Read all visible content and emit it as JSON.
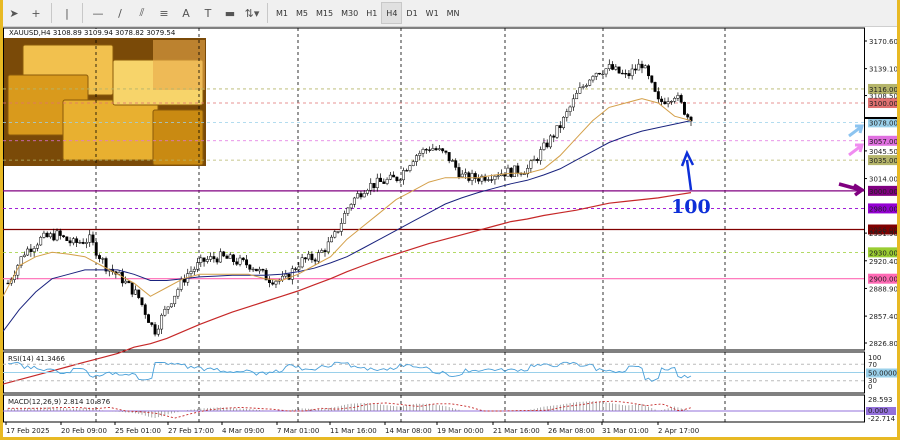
{
  "toolbar": {
    "tools": [
      {
        "name": "cursor-icon",
        "g": "➤"
      },
      {
        "name": "crosshair-icon",
        "g": "+"
      },
      {
        "name": "vertical-line-icon",
        "g": "|"
      },
      {
        "name": "horizontal-line-icon",
        "g": "—"
      },
      {
        "name": "trendline-icon",
        "g": "/"
      },
      {
        "name": "channels-icon",
        "g": "⫽"
      },
      {
        "name": "fibonacci-icon",
        "g": "≡"
      },
      {
        "name": "text-icon",
        "g": "A"
      },
      {
        "name": "text-label-icon",
        "g": "T"
      },
      {
        "name": "rectangle-icon",
        "g": "▬"
      },
      {
        "name": "arrows-icon",
        "g": "⇅▾"
      }
    ],
    "timeframes": [
      "M1",
      "M5",
      "M15",
      "M30",
      "H1",
      "H4",
      "D1",
      "W1",
      "MN"
    ],
    "active_timeframe": "H4"
  },
  "chart": {
    "symbol_header": "XAUUSD,H4  3108.89 3109.94 3078.82 3079.54",
    "price_ticks": [
      "3170.60",
      "3139.10",
      "3108.50",
      "3045.50",
      "3014.00",
      "2951.90",
      "2920.40",
      "2888.90",
      "2857.40",
      "2826.80"
    ],
    "levels": [
      {
        "label": "3116.00",
        "price": 3116,
        "color": "#b5b56a",
        "style": "dot"
      },
      {
        "label": "3100.00",
        "price": 3100,
        "color": "#e07070",
        "style": "dot"
      },
      {
        "label": "3078.00",
        "price": 3078,
        "color": "#9ad0ea",
        "style": "dot"
      },
      {
        "label": "3057.00",
        "price": 3057,
        "color": "#e070e0",
        "style": "dot"
      },
      {
        "label": "3035.00",
        "price": 3035,
        "color": "#b5b56a",
        "style": "dot"
      },
      {
        "label": "3000.00",
        "price": 3000,
        "color": "#800080",
        "style": "solid"
      },
      {
        "label": "2980.00",
        "price": 2980,
        "color": "#9400d3",
        "style": "dot"
      },
      {
        "label": "2956.00",
        "price": 2956,
        "color": "#800000",
        "style": "solid"
      },
      {
        "label": "2930.00",
        "price": 2930,
        "color": "#9acd32",
        "style": "dot"
      },
      {
        "label": "2900.00",
        "price": 2900,
        "color": "#ff69b4",
        "style": "solid"
      }
    ],
    "annotation": "100",
    "current_price": "3079.54",
    "close_path": [
      2895,
      2930,
      2945,
      2950,
      2940,
      2945,
      2915,
      2900,
      2880,
      2840,
      2875,
      2905,
      2920,
      2925,
      2920,
      2915,
      2900,
      2898,
      2920,
      2925,
      2945,
      2985,
      3005,
      3010,
      3015,
      3040,
      3050,
      3040,
      3015,
      3015,
      3020,
      3022,
      3025,
      3050,
      3075,
      3110,
      3135,
      3140,
      3130,
      3145,
      3100,
      3110,
      3079
    ],
    "ma_orange": [
      2880,
      2915,
      2925,
      2930,
      2928,
      2925,
      2915,
      2905,
      2895,
      2880,
      2890,
      2900,
      2905,
      2905,
      2905,
      2905,
      2900,
      2898,
      2905,
      2915,
      2925,
      2945,
      2960,
      2975,
      2990,
      3000,
      3010,
      3015,
      3015,
      3015,
      3018,
      3020,
      3020,
      3025,
      3040,
      3060,
      3080,
      3095,
      3100,
      3105,
      3100,
      3085,
      3080
    ],
    "ma_blue": [
      2840,
      2865,
      2885,
      2900,
      2905,
      2910,
      2910,
      2910,
      2905,
      2898,
      2898,
      2900,
      2902,
      2903,
      2904,
      2904,
      2904,
      2905,
      2908,
      2912,
      2918,
      2925,
      2935,
      2945,
      2955,
      2965,
      2975,
      2985,
      2992,
      2998,
      3003,
      3008,
      3012,
      3018,
      3025,
      3035,
      3045,
      3055,
      3062,
      3068,
      3072,
      3076,
      3080
    ],
    "ma_red": [
      2780,
      2785,
      2790,
      2795,
      2800,
      2805,
      2810,
      2815,
      2822,
      2826,
      2832,
      2840,
      2848,
      2855,
      2862,
      2868,
      2874,
      2880,
      2886,
      2893,
      2900,
      2908,
      2915,
      2922,
      2928,
      2934,
      2940,
      2945,
      2950,
      2955,
      2960,
      2965,
      2968,
      2972,
      2975,
      2978,
      2982,
      2986,
      2988,
      2990,
      2992,
      2995,
      2998
    ]
  },
  "rsi": {
    "label": "RSI(14) 41.3466",
    "ticks": [
      "100",
      "70",
      "30",
      "0"
    ],
    "level_label": "50.0000"
  },
  "macd": {
    "label": "MACD(12,26,9) 2.814 10.876",
    "ticks": [
      "28.593",
      "-22.714"
    ],
    "zero_label": "0.000"
  },
  "time_labels": [
    "17 Feb 2025",
    "20 Feb 09:00",
    "25 Feb 01:00",
    "27 Feb 17:00",
    "4 Mar 09:00",
    "7 Mar 01:00",
    "11 Mar 16:00",
    "14 Mar 08:00",
    "19 Mar 00:00",
    "21 Mar 16:00",
    "26 Mar 08:00",
    "31 Mar 01:00",
    "2 Apr 17:00"
  ],
  "colors": {
    "bull": "#000000",
    "ma_orange": "#d4a04a",
    "ma_blue": "#1a237e",
    "ma_red": "#c62828",
    "rsi": "#4a9fd8",
    "macd_signal": "#c62828",
    "annotation": "#0d2fd8"
  }
}
